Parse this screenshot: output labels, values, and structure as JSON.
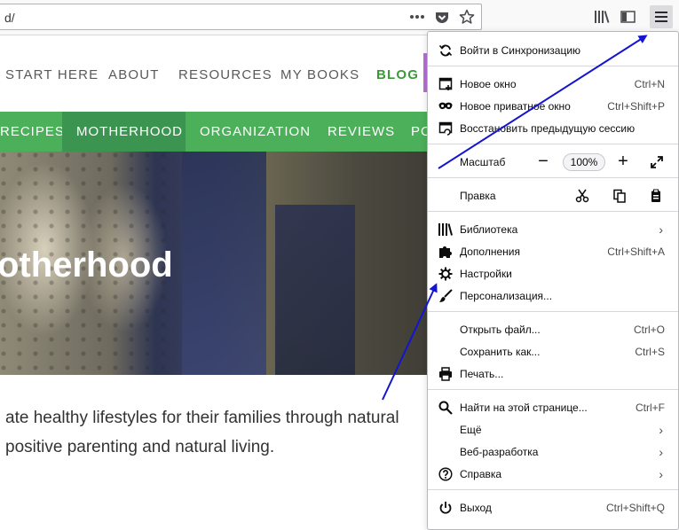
{
  "browser": {
    "url_fragment": "d/",
    "colors": {
      "toolbar_bg": "#f9f9fa",
      "menu_button_bg": "#dcdcde"
    }
  },
  "site": {
    "nav_top": [
      "START HERE",
      "ABOUT",
      "RESOURCES",
      "MY BOOKS",
      "BLOG"
    ],
    "nav_categories": [
      "RECIPES",
      "MOTHERHOOD",
      "ORGANIZATION",
      "REVIEWS",
      "PO"
    ],
    "active_category": "MOTHERHOOD",
    "hero_title": "otherhood",
    "paragraph_line1": "ate healthy lifestyles for their families through natural",
    "paragraph_line2": "positive parenting and natural living.",
    "colors": {
      "category_bar": "#4caf5a",
      "category_active": "#3b9450",
      "blog_link": "#3a9a3a"
    }
  },
  "menu": {
    "sync": "Войти в Синхронизацию",
    "new_window": {
      "label": "Новое окно",
      "shortcut": "Ctrl+N"
    },
    "private_window": {
      "label": "Новое приватное окно",
      "shortcut": "Ctrl+Shift+P"
    },
    "restore_session": "Восстановить предыдущую сессию",
    "zoom": {
      "label": "Масштаб",
      "value": "100%",
      "minus": "−",
      "plus": "+"
    },
    "edit": {
      "label": "Правка"
    },
    "library": "Библиотека",
    "addons": {
      "label": "Дополнения",
      "shortcut": "Ctrl+Shift+A"
    },
    "settings": "Настройки",
    "customize": "Персонализация...",
    "open_file": {
      "label": "Открыть файл...",
      "shortcut": "Ctrl+O"
    },
    "save_as": {
      "label": "Сохранить как...",
      "shortcut": "Ctrl+S"
    },
    "print": "Печать...",
    "find": {
      "label": "Найти на этой странице...",
      "shortcut": "Ctrl+F"
    },
    "more": "Ещё",
    "web_developer": "Веб-разработка",
    "help": "Справка",
    "quit": {
      "label": "Выход",
      "shortcut": "Ctrl+Shift+Q"
    }
  },
  "annotation_color": "#1414d2"
}
